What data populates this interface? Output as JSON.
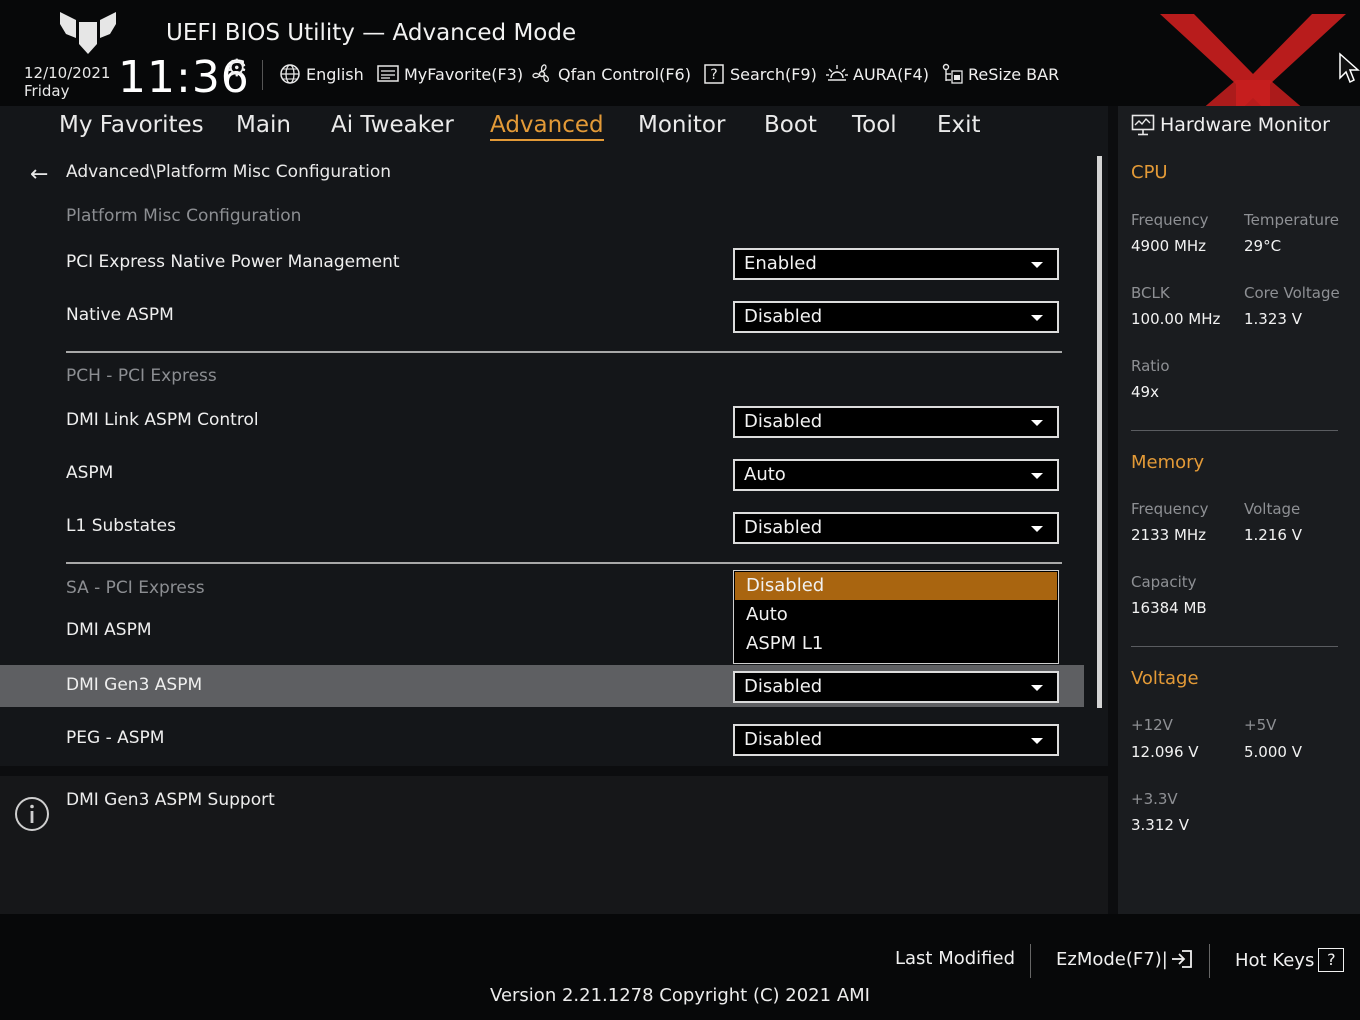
{
  "header": {
    "title": "UEFI BIOS Utility — Advanced Mode",
    "date": "12/10/2021",
    "day": "Friday",
    "time": "11:36",
    "toolbar": [
      {
        "label": "English",
        "icon": "globe-icon"
      },
      {
        "label": "MyFavorite(F3)",
        "icon": "favorite-icon"
      },
      {
        "label": "Qfan Control(F6)",
        "icon": "fan-icon"
      },
      {
        "label": "Search(F9)",
        "icon": "search-icon"
      },
      {
        "label": "AURA(F4)",
        "icon": "aura-icon"
      },
      {
        "label": "ReSize BAR",
        "icon": "resize-bar-icon"
      }
    ]
  },
  "nav": {
    "tabs": [
      "My Favorites",
      "Main",
      "Ai Tweaker",
      "Advanced",
      "Monitor",
      "Boot",
      "Tool",
      "Exit"
    ],
    "active": "Advanced"
  },
  "main": {
    "breadcrumb": "Advanced\\Platform Misc Configuration",
    "sections": [
      "Platform Misc Configuration",
      "PCH - PCI Express",
      "SA - PCI Express"
    ],
    "settings": [
      {
        "label": "PCI Express Native Power Management",
        "value": "Enabled"
      },
      {
        "label": "Native ASPM",
        "value": "Disabled"
      },
      {
        "label": "DMI Link ASPM Control",
        "value": "Disabled"
      },
      {
        "label": "ASPM",
        "value": "Auto"
      },
      {
        "label": "L1 Substates",
        "value": "Disabled"
      },
      {
        "label": "DMI ASPM",
        "value": ""
      },
      {
        "label": "DMI Gen3 ASPM",
        "value": "Disabled"
      },
      {
        "label": "PEG - ASPM",
        "value": "Disabled"
      }
    ],
    "selected_setting": "DMI Gen3 ASPM",
    "dropdown": {
      "options": [
        "Disabled",
        "Auto",
        "ASPM L1"
      ],
      "highlighted": "Disabled"
    }
  },
  "help": {
    "text": "DMI Gen3 ASPM Support"
  },
  "hardware_monitor": {
    "title": "Hardware Monitor",
    "cpu": {
      "title": "CPU",
      "frequency_label": "Frequency",
      "frequency": "4900 MHz",
      "temperature_label": "Temperature",
      "temperature": "29°C",
      "bclk_label": "BCLK",
      "bclk": "100.00 MHz",
      "core_voltage_label": "Core Voltage",
      "core_voltage": "1.323 V",
      "ratio_label": "Ratio",
      "ratio": "49x"
    },
    "memory": {
      "title": "Memory",
      "frequency_label": "Frequency",
      "frequency": "2133 MHz",
      "voltage_label": "Voltage",
      "voltage": "1.216 V",
      "capacity_label": "Capacity",
      "capacity": "16384 MB"
    },
    "voltage": {
      "title": "Voltage",
      "v12_label": "+12V",
      "v12": "12.096 V",
      "v5_label": "+5V",
      "v5": "5.000 V",
      "v33_label": "+3.3V",
      "v33": "3.312 V"
    }
  },
  "footer": {
    "last_modified": "Last Modified",
    "ezmode": "EzMode(F7)|",
    "hotkeys": "Hot Keys",
    "hotkeys_key": "?",
    "version": "Version 2.21.1278 Copyright (C) 2021 AMI"
  },
  "colors": {
    "accent": "#e39a37",
    "dropdown_highlight": "#a96510",
    "selected_row": "#5e5f62",
    "watermark": "#c81e1e"
  }
}
